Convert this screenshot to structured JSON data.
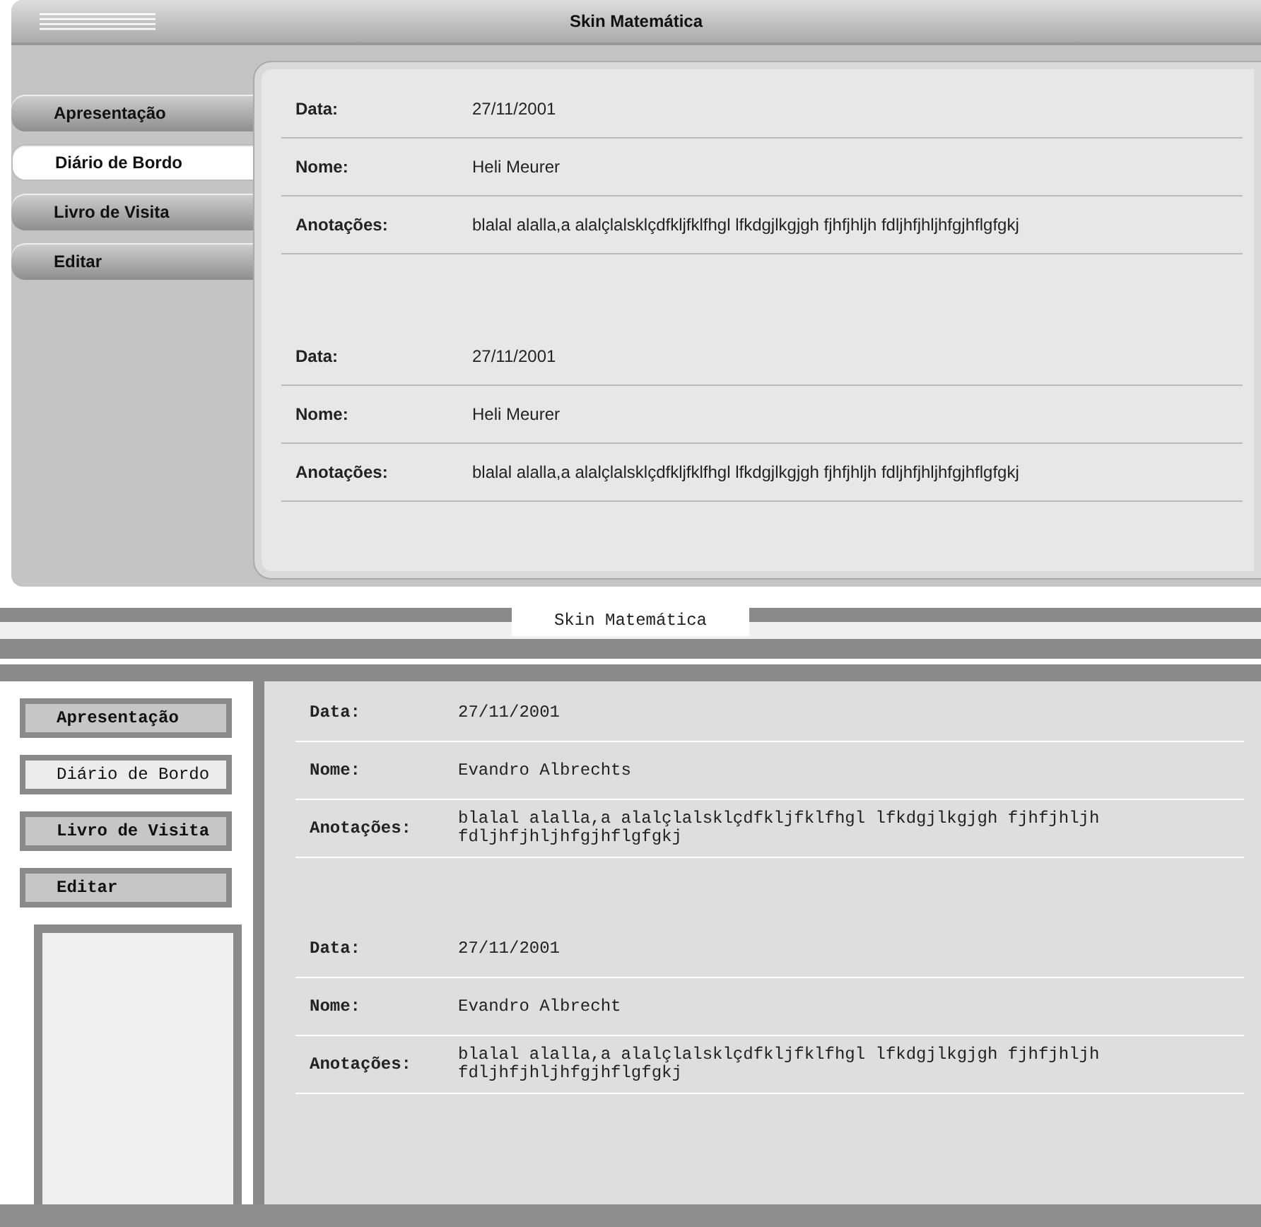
{
  "skins": [
    {
      "kind": "modern",
      "title": "Skin Matemática",
      "menu": [
        {
          "label": "Apresentação",
          "selected": false
        },
        {
          "label": "Diário de Bordo",
          "selected": true
        },
        {
          "label": "Livro de Visita",
          "selected": false
        },
        {
          "label": "Editar",
          "selected": false
        }
      ],
      "entries": [
        {
          "fields": [
            {
              "label": "Data:",
              "value": "27/11/2001"
            },
            {
              "label": "Nome:",
              "value": "Heli Meurer"
            },
            {
              "label": "Anotações:",
              "value": "blalal alalla,a alalçlalsklçdfkljfklfhgl lfkdgjlkgjgh fjhfjhljh fdljhfjhljhfgjhflgfgkj"
            }
          ]
        },
        {
          "fields": [
            {
              "label": "Data:",
              "value": "27/11/2001"
            },
            {
              "label": "Nome:",
              "value": "Heli Meurer"
            },
            {
              "label": "Anotações:",
              "value": "blalal alalla,a alalçlalsklçdfkljfklfhgl lfkdgjlkgjgh fjhfjhljh fdljhfjhljhfgjhflgfgkj"
            }
          ]
        }
      ]
    },
    {
      "kind": "sketch",
      "title": "Skin Matemática",
      "menu": [
        {
          "label": "Apresentação",
          "selected": false
        },
        {
          "label": "Diário de Bordo",
          "selected": true
        },
        {
          "label": "Livro de Visita",
          "selected": false
        },
        {
          "label": "Editar",
          "selected": false
        }
      ],
      "entries": [
        {
          "fields": [
            {
              "label": "Data:",
              "value": "27/11/2001"
            },
            {
              "label": "Nome:",
              "value": "Evandro Albrechts"
            },
            {
              "label": "Anotações:",
              "value": "blalal alalla,a alalçlalsklçdfkljfklfhgl lfkdgjlkgjgh fjhfjhljh fdljhfjhljhfgjhflgfgkj"
            }
          ]
        },
        {
          "fields": [
            {
              "label": "Data:",
              "value": "27/11/2001"
            },
            {
              "label": "Nome:",
              "value": "Evandro Albrecht"
            },
            {
              "label": "Anotações:",
              "value": "blalal alalla,a alalçlalsklçdfkljfklfhgl lfkdgjlkgjgh fjhfjhljh fdljhfjhljhfgjhflgfgkj"
            }
          ]
        }
      ]
    }
  ]
}
